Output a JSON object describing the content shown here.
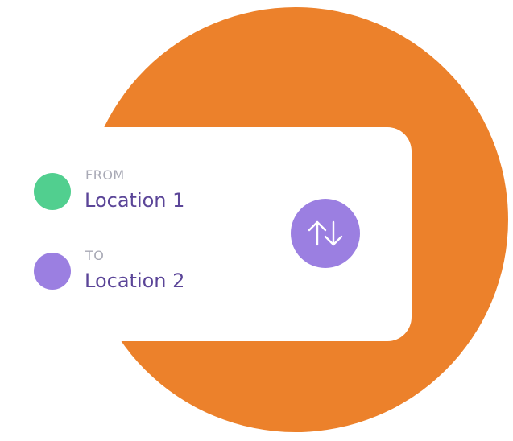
{
  "colors": {
    "background_circle": "#ec812b",
    "card": "#ffffff",
    "from_dot": "#51cf8f",
    "to_dot": "#9b7fe1",
    "swap_button": "#9b7fe1",
    "label": "#a8a9b5",
    "value": "#5b4598"
  },
  "route": {
    "from": {
      "label": "FROM",
      "value": "Location 1"
    },
    "to": {
      "label": "TO",
      "value": "Location 2"
    }
  },
  "swap_button": {
    "icon": "swap-vertical-arrows-icon"
  }
}
